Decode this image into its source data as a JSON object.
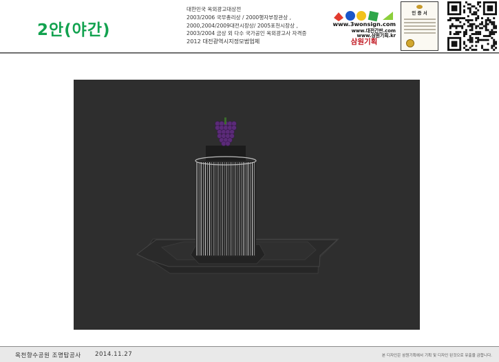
{
  "header": {
    "title": "2안(야간)",
    "awards": [
      "대한민국 옥외광고대상전",
      "2003/2006 국무총리상 / 2000행자부장관상 ,",
      "2000,2004/2009대전시장상/ 2005포천시장상 ,",
      "2003/2004 금상 외 다수  국가공인 옥외광고사 자격증",
      "2012 대전광역시지정모범업체"
    ],
    "brand": {
      "url_1": "www.3wonsign.com",
      "url_2": "www.대전간판.com",
      "url_3": "www.삼원기획.kr",
      "name": "삼원기획",
      "gem_colors": [
        "#e23b2e",
        "#1a56c9",
        "#f2c21b",
        "#2fa64a",
        "#8ccf3c"
      ]
    },
    "certificate": {
      "title": "인 증 서"
    },
    "qr_icon": "qr-code-icon"
  },
  "render": {
    "description_icon": "fountain-night-render",
    "background_color": "#2e2e2e",
    "light_color": "#e8e8e8",
    "grape_color": "#5b2b78"
  },
  "footer": {
    "project": "옥천향수공원 조명탑공사",
    "date": "2014.11.27",
    "notice": "본 디자인은 삼원기획에서 기획 및 디자인 된것으로 유출을 금합니다."
  }
}
